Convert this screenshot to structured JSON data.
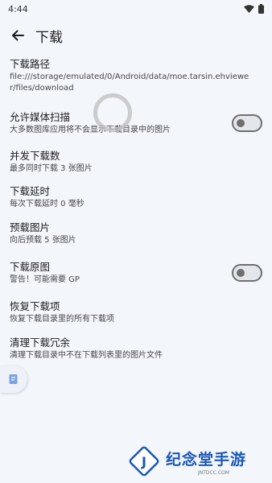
{
  "status_bar": {
    "time": "4:44"
  },
  "header": {
    "title": "下载"
  },
  "settings": [
    {
      "title": "下载路径",
      "summary": "file:///storage/emulated/0/Android/data/moe.tarsin.ehviewer/files/download",
      "has_switch": false
    },
    {
      "title": "允许媒体扫描",
      "summary": "大多数图库应用将不会显示下载目录中的图片",
      "has_switch": true,
      "switch_on": false
    },
    {
      "title": "并发下载数",
      "summary": "最多同时下载 3 张图片",
      "has_switch": false
    },
    {
      "title": "下载延时",
      "summary": "每次下载延时 0 毫秒",
      "has_switch": false
    },
    {
      "title": "预载图片",
      "summary": "向后预载 5 张图片",
      "has_switch": false
    },
    {
      "title": "下载原图",
      "summary": "警告！可能需要 GP",
      "has_switch": true,
      "switch_on": false
    },
    {
      "title": "恢复下载项",
      "summary": "恢复下载目录里的所有下载项",
      "has_switch": false
    },
    {
      "title": "清理下载冗余",
      "summary": "清理下载目录中不在下载列表里的图片文件",
      "has_switch": false
    }
  ],
  "watermark": {
    "text": "纪念堂手游",
    "sub": "JNTDCC.COM"
  },
  "icons": {
    "back": "arrow-left-icon",
    "wifi": "wifi-icon",
    "battery": "battery-icon",
    "side": "note-icon"
  }
}
